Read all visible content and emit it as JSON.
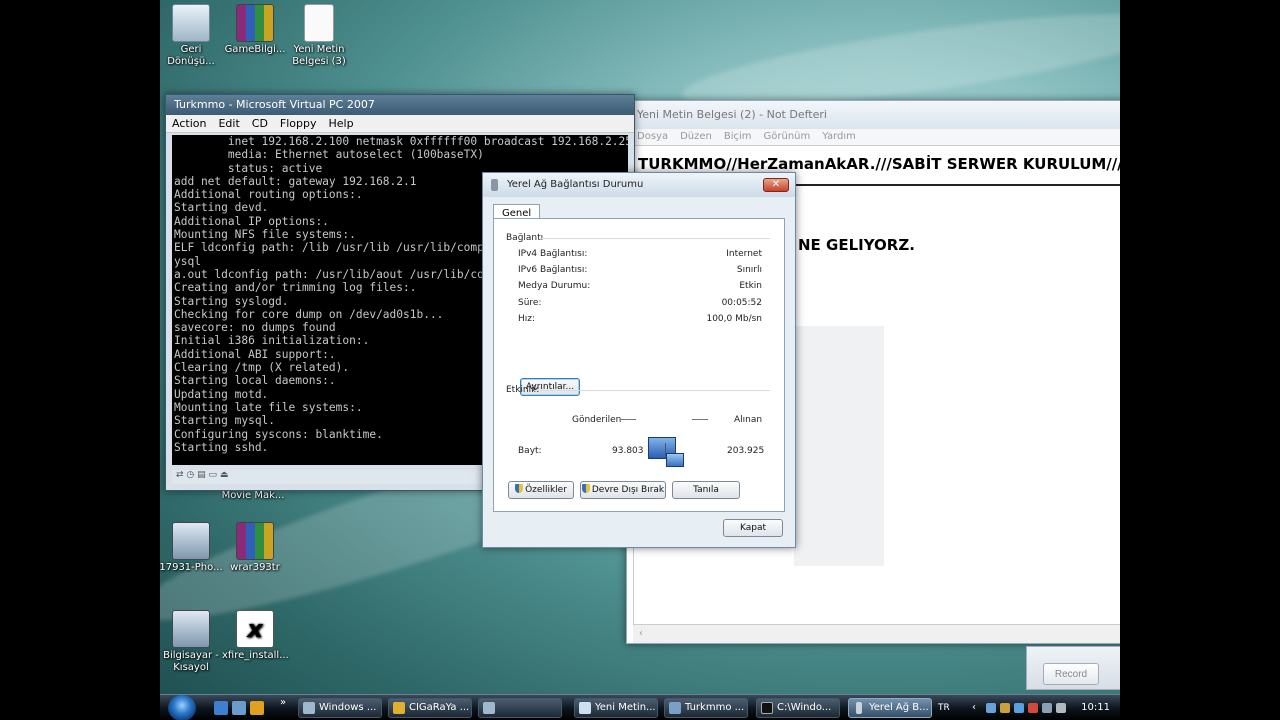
{
  "desktop": {
    "icons": [
      {
        "label": "Geri Dönüşü...",
        "icon": "recycle-bin-icon"
      },
      {
        "label": "GameBilgi...",
        "icon": "winrar-archive-icon"
      },
      {
        "label": "Yeni Metin Belgesi (3)",
        "icon": "text-document-icon"
      },
      {
        "label": "Movie Mak...",
        "icon": "movie-maker-icon"
      },
      {
        "label": "17931-Pho...",
        "icon": "computer-setup-icon"
      },
      {
        "label": "wrar393tr",
        "icon": "winrar-installer-icon"
      },
      {
        "label": "Bilgisayar - Kısayol",
        "icon": "computer-shortcut-icon"
      },
      {
        "label": "xfire_install...",
        "icon": "xfire-icon"
      }
    ]
  },
  "vpc": {
    "title": "Turkmmo - Microsoft Virtual PC 2007",
    "menu": [
      "Action",
      "Edit",
      "CD",
      "Floppy",
      "Help"
    ],
    "console_lines": [
      "        inet 192.168.2.100 netmask 0xffffff00 broadcast 192.168.2.255",
      "        media: Ethernet autoselect (100baseTX)",
      "        status: active",
      "add net default: gateway 192.168.2.1",
      "Additional routing options:.",
      "Starting devd.",
      "Additional IP options:.",
      "Mounting NFS file systems:.",
      "ELF ldconfig path: /lib /usr/lib /usr/lib/compat /usr/local/lib /usr/local/lib/m",
      "ysql",
      "a.out ldconfig path: /usr/lib/aout /usr/lib/compat/aout",
      "Creating and/or trimming log files:.",
      "Starting syslogd.",
      "Checking for core dump on /dev/ad0s1b...",
      "savecore: no dumps found",
      "Initial i386 initialization:.",
      "Additional ABI support:.",
      "Clearing /tmp (X related).",
      "Starting local daemons:.",
      "Updating motd.",
      "Mounting late file systems:.",
      "Starting mysql.",
      "Configuring syscons: blanktime.",
      "Starting sshd."
    ]
  },
  "notepad": {
    "title": "Yeni Metin Belgesi (2) - Not Defteri",
    "menu": [
      "Dosya",
      "Düzen",
      "Biçim",
      "Görünüm",
      "Yardım"
    ],
    "line1": "TURKMMO//HerZamanAkAR.///SABİT SERWER KURULUM///",
    "line2": "NE GELIYORZ."
  },
  "record_panel": {
    "button": "Record"
  },
  "dialog": {
    "title": "Yerel Ağ Bağlantısı Durumu",
    "close": "✕",
    "tab": "Genel",
    "connection_group": "Bağlantı",
    "rows": [
      {
        "label": "IPv4 Bağlantısı:",
        "value": "Internet"
      },
      {
        "label": "IPv6 Bağlantısı:",
        "value": "Sınırlı"
      },
      {
        "label": "Medya Durumu:",
        "value": "Etkin"
      },
      {
        "label": "Süre:",
        "value": "00:05:52"
      },
      {
        "label": "Hız:",
        "value": "100,0 Mb/sn"
      }
    ],
    "details_button": "Ayrıntılar...",
    "activity_group": "Etkinlik",
    "sent_label": "Gönderilen",
    "received_label": "Alınan",
    "bytes_label": "Bayt:",
    "bytes_sent": "93.803",
    "bytes_received": "203.925",
    "properties_button": "Özellikler",
    "disable_button": "Devre Dışı Bırak",
    "diagnose_button": "Tanıla",
    "close_button": "Kapat"
  },
  "taskbar": {
    "tasks": [
      {
        "label": "Windows ...",
        "icon": "folder-icon"
      },
      {
        "label": "CIGaRaYa ...",
        "icon": "browser-icon"
      },
      {
        "label": "",
        "icon": "camera-icon"
      },
      {
        "label": "Yeni Metin...",
        "icon": "notepad-icon"
      },
      {
        "label": "Turkmmo ...",
        "icon": "virtual-pc-icon"
      },
      {
        "label": "C:\\Windo...",
        "icon": "cmd-icon"
      },
      {
        "label": "Yerel Ağ B...",
        "icon": "network-plug-icon"
      }
    ],
    "language": "TR",
    "clock": "10:11"
  },
  "colors": {
    "accent": "#3b5a73",
    "console_bg": "#000000",
    "console_fg": "#c8c8c8"
  }
}
